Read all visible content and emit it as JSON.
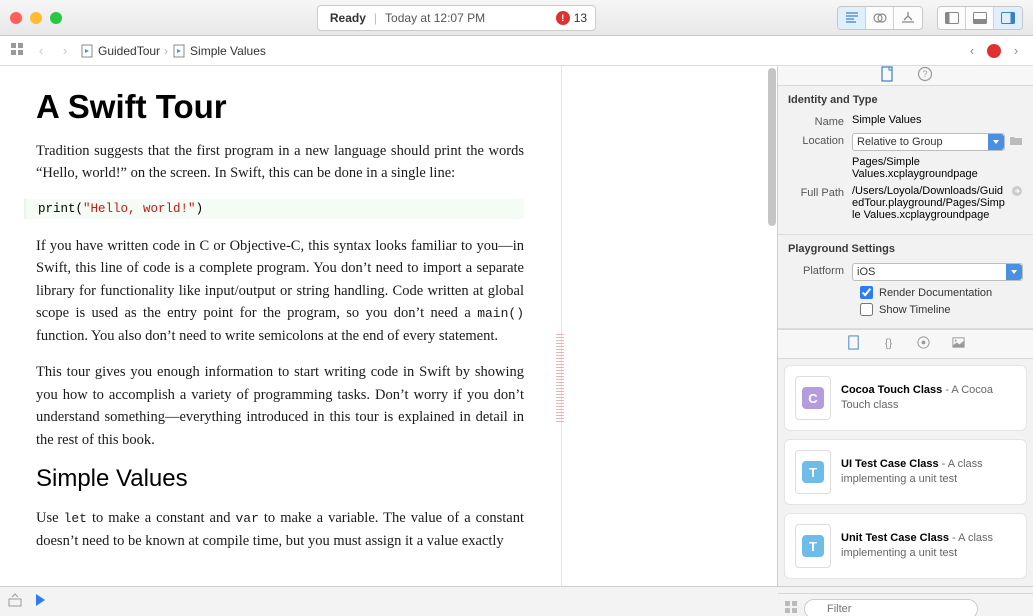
{
  "toolbar": {
    "status_label": "Ready",
    "status_time": "Today at 12:07 PM",
    "error_count": "13"
  },
  "jumpbar": {
    "crumb1": "GuidedTour",
    "crumb2": "Simple Values"
  },
  "document": {
    "h1": "A Swift Tour",
    "p1a": "Tradition suggests that the first program in a new language should print the words “Hello, world!” on the screen. In Swift, this can be done in a single line:",
    "code_fn": "print",
    "code_open": "(",
    "code_str": "\"Hello, world!\"",
    "code_close": ")",
    "p2a": "If you have written code in C or Objective-C, this syntax looks familiar to you—in Swift, this line of code is a complete program. You don’t need to import a separate library for functionality like input/output or string handling. Code written at global scope is used as the entry point for the program, so you don’t need a ",
    "p2b": "main()",
    "p2c": " function. You also don’t need to write semicolons at the end of every statement.",
    "p3": "This tour gives you enough information to start writing code in Swift by showing you how to accomplish a variety of programming tasks. Don’t worry if you don’t understand something—everything introduced in this tour is explained in detail in the rest of this book.",
    "h2": "Simple Values",
    "p4a": "Use ",
    "p4b": "let",
    "p4c": " to make a constant and ",
    "p4d": "var",
    "p4e": " to make a variable. The value of a constant doesn’t need to be known at compile time, but you must assign it a value exactly"
  },
  "inspector": {
    "identity_heading": "Identity and Type",
    "name_label": "Name",
    "name_value": "Simple Values",
    "location_label": "Location",
    "location_value": "Relative to Group",
    "location_path": "Pages/Simple Values.xcplaygroundpage",
    "fullpath_label": "Full Path",
    "fullpath_value": "/Users/Loyola/Downloads/GuidedTour.playground/Pages/Simple Values.xcplaygroundpage",
    "settings_heading": "Playground Settings",
    "platform_label": "Platform",
    "platform_value": "iOS",
    "render_doc_label": "Render Documentation",
    "show_timeline_label": "Show Timeline"
  },
  "library": {
    "items": [
      {
        "letter": "C",
        "tile": "c",
        "title": "Cocoa Touch Class",
        "desc": " - A Cocoa Touch class"
      },
      {
        "letter": "T",
        "tile": "t",
        "title": "UI Test Case Class",
        "desc": " - A class implementing a unit test"
      },
      {
        "letter": "T",
        "tile": "t",
        "title": "Unit Test Case Class",
        "desc": " - A class implementing a unit test"
      }
    ],
    "filter_placeholder": "Filter"
  }
}
